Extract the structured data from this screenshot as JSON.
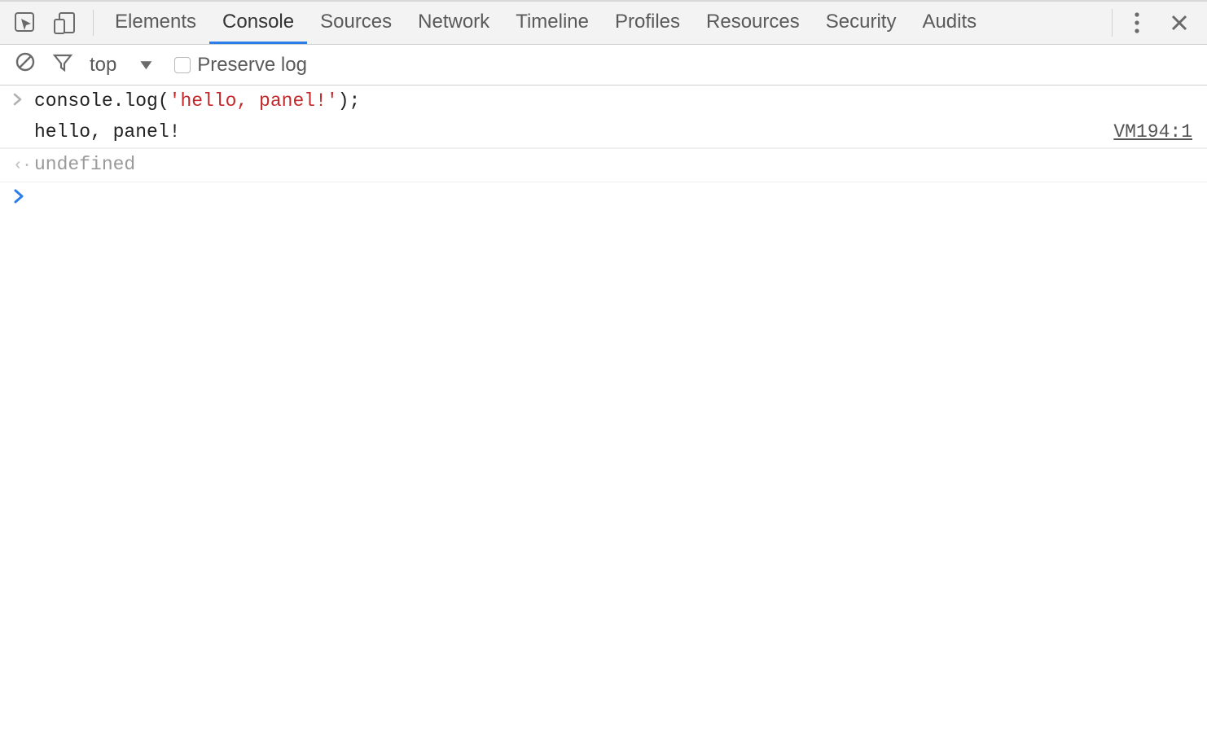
{
  "tabs": {
    "items": [
      {
        "label": "Elements",
        "active": false
      },
      {
        "label": "Console",
        "active": true
      },
      {
        "label": "Sources",
        "active": false
      },
      {
        "label": "Network",
        "active": false
      },
      {
        "label": "Timeline",
        "active": false
      },
      {
        "label": "Profiles",
        "active": false
      },
      {
        "label": "Resources",
        "active": false
      },
      {
        "label": "Security",
        "active": false
      },
      {
        "label": "Audits",
        "active": false
      }
    ]
  },
  "toolbar": {
    "context": "top",
    "preserve_log_label": "Preserve log",
    "preserve_log_checked": false
  },
  "console": {
    "input_call": "console.log(",
    "input_str": "'hello, panel!'",
    "input_tail": ");",
    "output_text": "hello, panel!",
    "output_source": "VM194:1",
    "return_value": "undefined"
  }
}
